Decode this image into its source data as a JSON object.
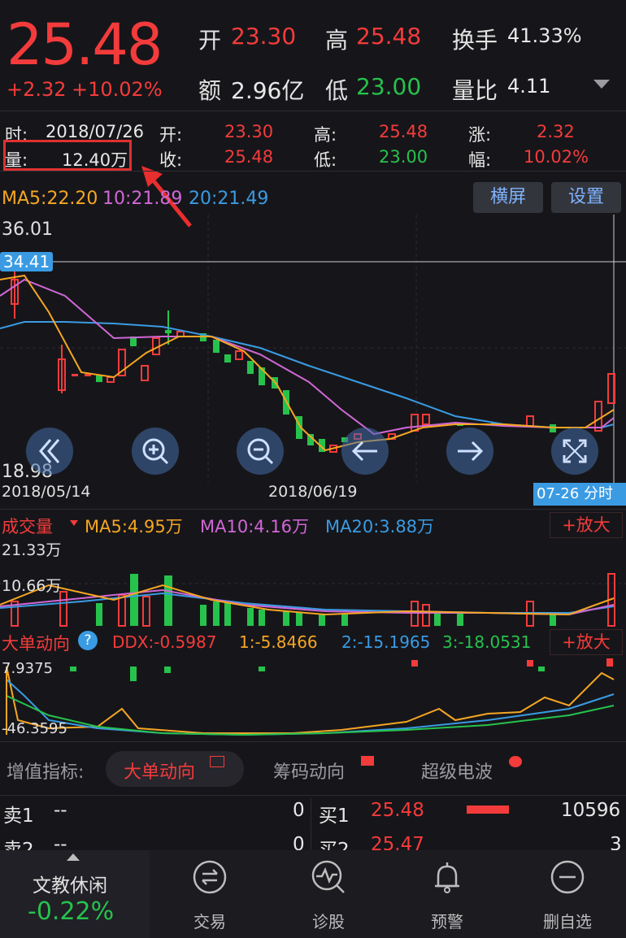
{
  "quote": {
    "price": "25.48",
    "change": "+2.32",
    "change_pct": "+10.02%",
    "open_label": "开",
    "open": "23.30",
    "high_label": "高",
    "high": "25.48",
    "turnover_label": "换手",
    "turnover": "41.33%",
    "amount_label": "额",
    "amount": "2.96亿",
    "low_label": "低",
    "low": "23.00",
    "volume_ratio_label": "量比",
    "volume_ratio": "4.11"
  },
  "detail": {
    "time_label": "时:",
    "time": "2018/07/26",
    "open_label": "开:",
    "open": "23.30",
    "high_label": "高:",
    "high": "25.48",
    "rise_label": "涨:",
    "rise": "2.32",
    "vol_label": "量:",
    "vol": "12.40万",
    "close_label": "收:",
    "close": "25.48",
    "low_label": "低:",
    "low": "23.00",
    "range_label": "幅:",
    "range": "10.02%"
  },
  "kline": {
    "ma5": "MA5:22.20",
    "ma10": "10:21.89",
    "ma20": "20:21.49",
    "landscape_button": "横屏",
    "settings_button": "设置",
    "price_high": "36.01",
    "price_crosshair": "34.41",
    "price_low": "18.98",
    "date_left": "2018/05/14",
    "date_mid": "2018/06/19",
    "time_share_tag": "07-26 分时",
    "colors": {
      "ma5": "#f5a623",
      "ma10": "#d067d6",
      "ma20": "#3a9be3",
      "up": "#f43b3b",
      "down": "#27c24c"
    }
  },
  "volume": {
    "title": "成交量",
    "ma5": "MA5:4.95万",
    "ma10": "MA10:4.16万",
    "ma20": "MA20:3.88万",
    "zoom_button": "+放大",
    "tick_top": "21.33万",
    "tick_mid": "10.66万"
  },
  "ddx": {
    "title": "大单动向",
    "help": "?",
    "ddx": "DDX:-0.5987",
    "v1": "1:-5.8466",
    "v2": "2:-15.1965",
    "v3": "3:-18.0531",
    "zoom_button": "+放大",
    "tick_top": "7.9375",
    "tick_bottom": "-46.3595"
  },
  "indicator_tabs": {
    "label": "增值指标:",
    "tabs": [
      "大单动向",
      "筹码动向",
      "超级电波"
    ]
  },
  "order_book": {
    "sell1_label": "卖1",
    "sell1_price": "--",
    "sell1_vol": "0",
    "sell2_label": "卖2",
    "sell2_price": "--",
    "sell2_vol": "0",
    "buy1_label": "买1",
    "buy1_price": "25.48",
    "buy1_vol": "10596",
    "buy2_label": "买2",
    "buy2_price": "25.47",
    "buy2_vol": "3"
  },
  "bottom_nav": {
    "sector": "文教休闲",
    "sector_change": "-0.22%",
    "items": [
      "交易",
      "诊股",
      "预警",
      "删自选"
    ]
  }
}
